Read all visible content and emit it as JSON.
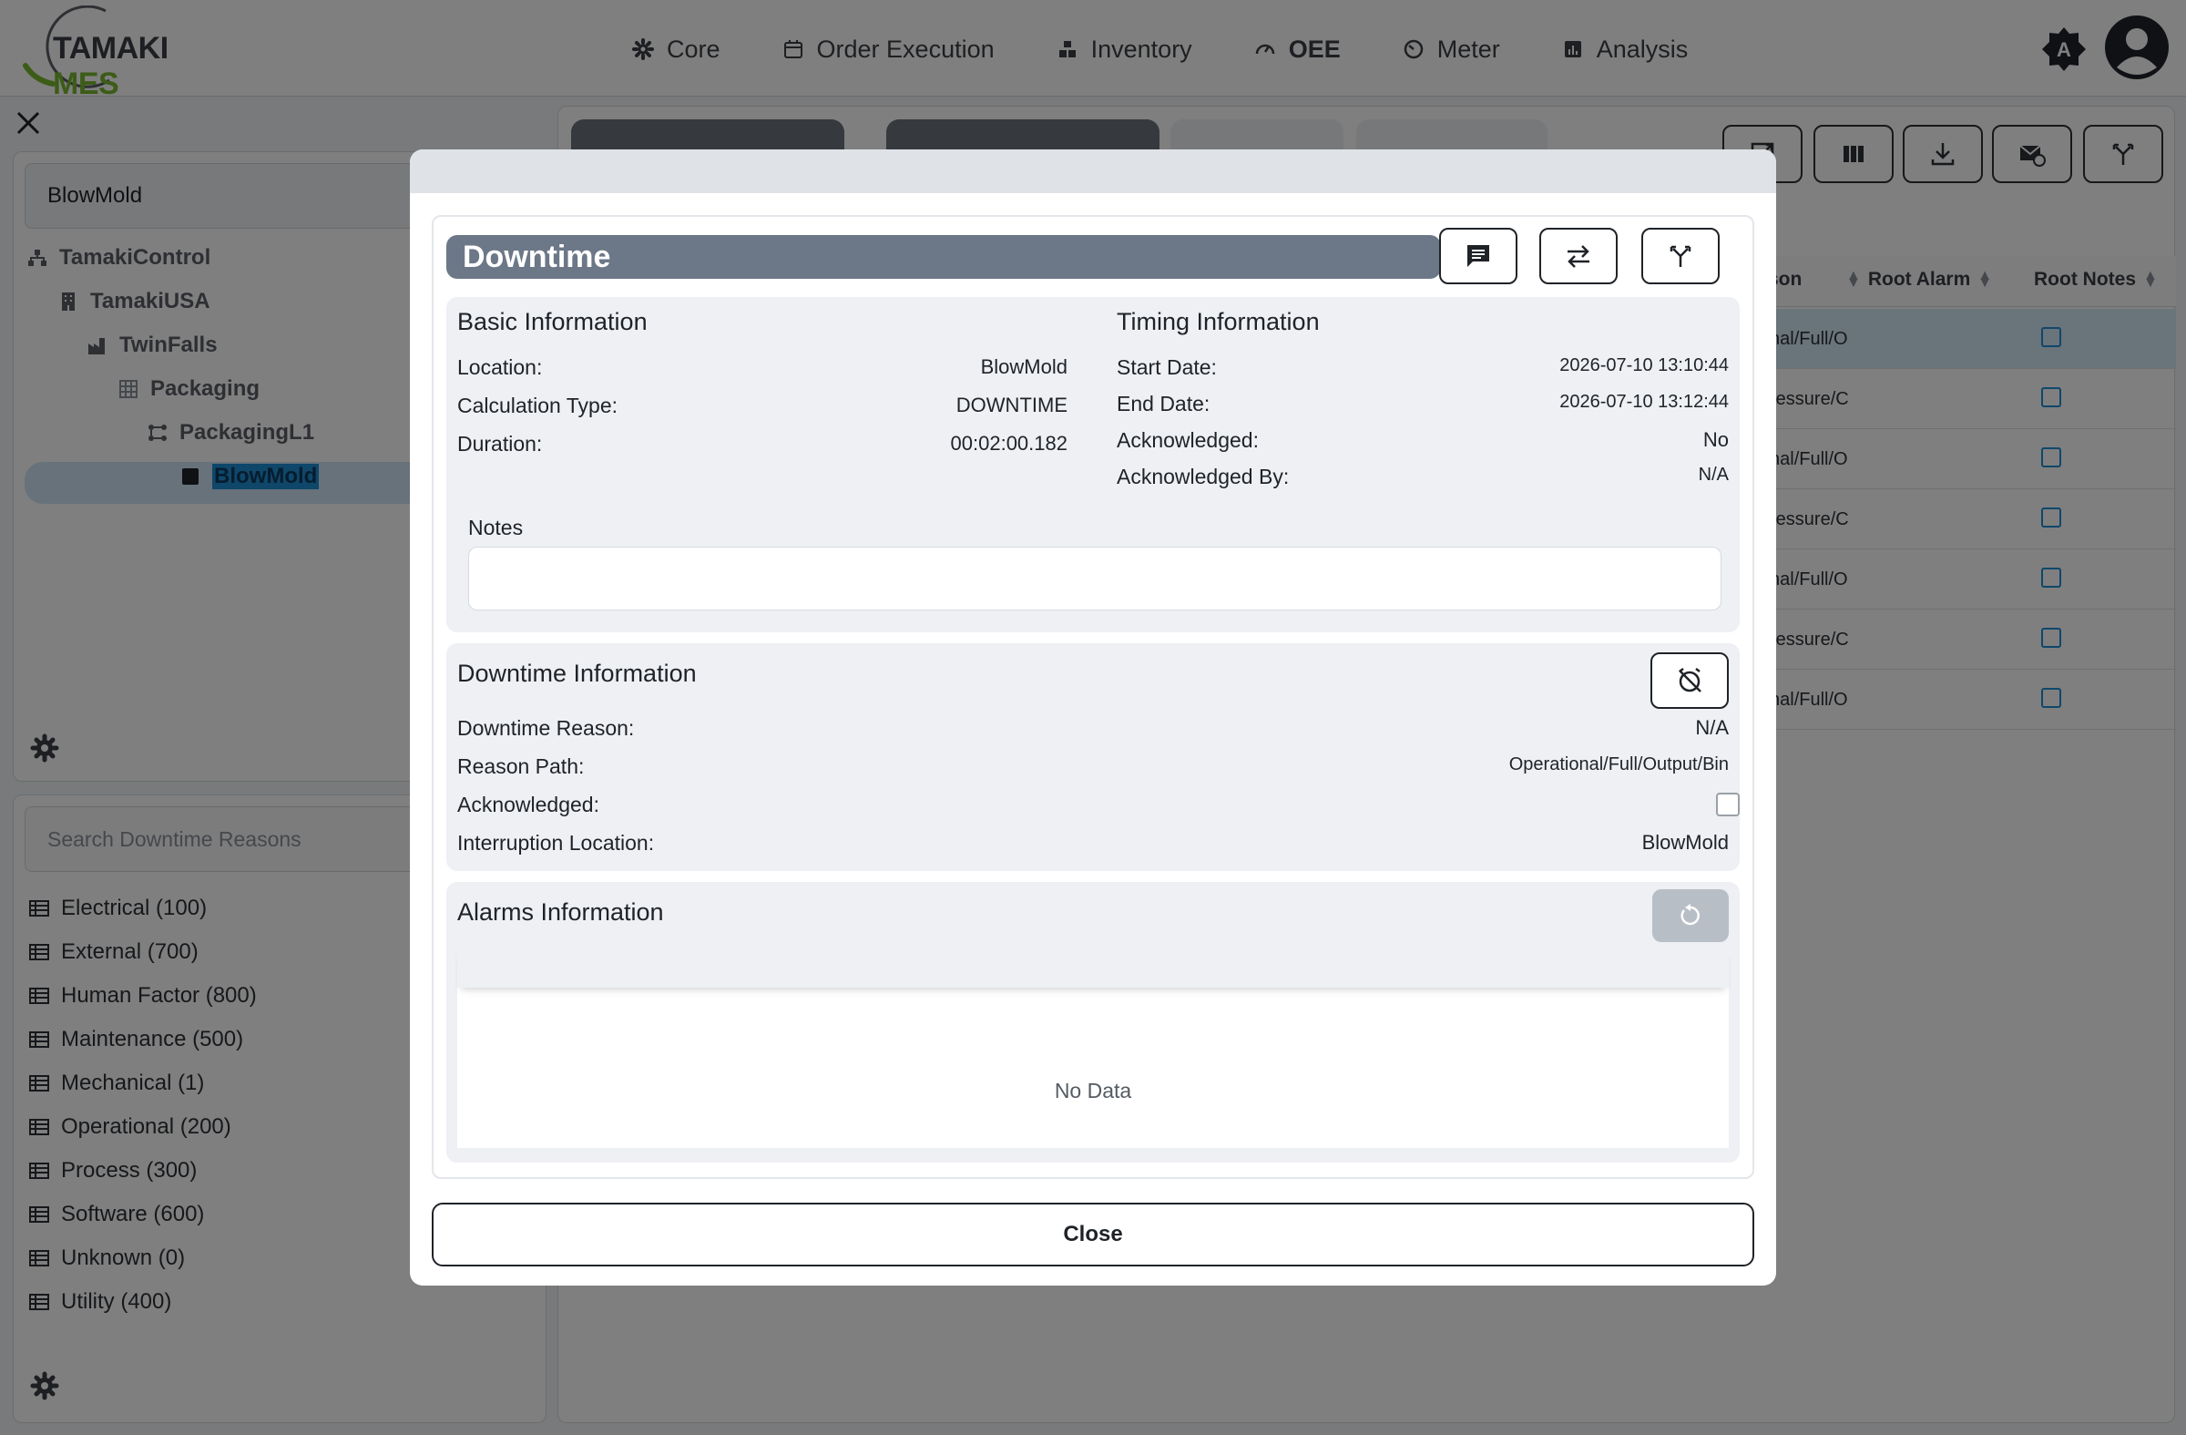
{
  "app": {
    "logo_text_1": "TAMAKI",
    "logo_text_2": "MES"
  },
  "nav": [
    {
      "label": "Core",
      "icon": "gear-icon",
      "active": false
    },
    {
      "label": "Order Execution",
      "icon": "calendar-icon",
      "active": false
    },
    {
      "label": "Inventory",
      "icon": "boxes-icon",
      "active": false
    },
    {
      "label": "OEE",
      "icon": "gauge-icon",
      "active": true
    },
    {
      "label": "Meter",
      "icon": "meter-icon",
      "active": false
    },
    {
      "label": "Analysis",
      "icon": "chart-icon",
      "active": false
    }
  ],
  "theme_badge": "A",
  "location": {
    "input_value": "BlowMold",
    "tree": [
      {
        "label": "TamakiControl",
        "level": 0,
        "icon": "org-icon"
      },
      {
        "label": "TamakiUSA",
        "level": 1,
        "icon": "building-icon"
      },
      {
        "label": "TwinFalls",
        "level": 2,
        "icon": "factory-icon"
      },
      {
        "label": "Packaging",
        "level": 3,
        "icon": "grid-icon"
      },
      {
        "label": "PackagingL1",
        "level": 4,
        "icon": "line-icon"
      },
      {
        "label": "BlowMold",
        "level": 5,
        "icon": "machine-icon",
        "selected": true
      }
    ]
  },
  "reasons": {
    "search_placeholder": "Search Downtime Reasons",
    "items": [
      "Electrical (100)",
      "External (700)",
      "Human Factor (800)",
      "Maintenance (500)",
      "Mechanical (1)",
      "Operational (200)",
      "Process (300)",
      "Software (600)",
      "Unknown (0)",
      "Utility (400)"
    ]
  },
  "table": {
    "col_partial": "son",
    "col_root_alarm": "Root Alarm",
    "col_root_notes": "Root Notes",
    "rows": [
      "nal/Full/O",
      "ressure/C",
      "nal/Full/O",
      "ressure/C",
      "nal/Full/O",
      "ressure/C",
      "nal/Full/O"
    ]
  },
  "modal": {
    "title": "Downtime",
    "basic": {
      "title": "Basic Information",
      "rows": [
        {
          "label": "Location:",
          "value": "BlowMold"
        },
        {
          "label": "Calculation Type:",
          "value": "DOWNTIME"
        },
        {
          "label": "Duration:",
          "value": "00:02:00.182"
        }
      ]
    },
    "timing": {
      "title": "Timing Information",
      "rows": [
        {
          "label": "Start Date:",
          "value": "2026-07-10 13:10:44"
        },
        {
          "label": "End Date:",
          "value": "2026-07-10 13:12:44"
        },
        {
          "label": "Acknowledged:",
          "value": "No"
        },
        {
          "label": "Acknowledged By:",
          "value": "N/A"
        }
      ]
    },
    "notes_label": "Notes",
    "notes_value": "",
    "downtime": {
      "title": "Downtime Information",
      "rows": [
        {
          "label": "Downtime Reason:",
          "value": "N/A"
        },
        {
          "label": "Reason Path:",
          "value": "Operational/Full/Output/Bin"
        },
        {
          "label": "Acknowledged:",
          "value": ""
        },
        {
          "label": "Interruption Location:",
          "value": "BlowMold"
        }
      ]
    },
    "alarms": {
      "title": "Alarms Information",
      "empty_text": "No Data"
    },
    "close_label": "Close"
  }
}
